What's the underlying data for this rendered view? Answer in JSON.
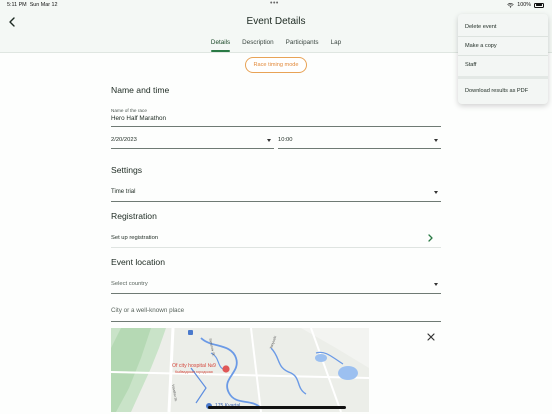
{
  "status_bar": {
    "time": "5:11 PM",
    "date": "Sun Mar 12",
    "battery": "100%"
  },
  "header": {
    "title": "Event Details",
    "tabs": [
      {
        "label": "Details",
        "active": true
      },
      {
        "label": "Description",
        "active": false
      },
      {
        "label": "Participants",
        "active": false
      },
      {
        "label": "Lap",
        "active": false
      }
    ]
  },
  "race_timing_button": "Race timing mode",
  "name_and_time": {
    "section_title": "Name and time",
    "race_name_label": "Name of the race",
    "race_name_value": "Hero Half Marathon",
    "date_value": "2/20/2023",
    "time_value": "10:00"
  },
  "settings": {
    "section_title": "Settings",
    "type_value": "Time trial"
  },
  "registration": {
    "section_title": "Registration",
    "setup_label": "Set up registration"
  },
  "event_location": {
    "section_title": "Event location",
    "country_placeholder": "Select country",
    "city_placeholder": "City or a well-known place"
  },
  "map": {
    "hospital_label": "Of city hospital №9",
    "hospital_sublabel": "Кыйвадская городская",
    "metro_label": "175 Kvartal",
    "street_labels": [
      "Simonov St.",
      "Vessilov St.",
      "Tanyushi"
    ]
  },
  "context_menu": {
    "items": [
      "Delete event",
      "Make a copy",
      "Staff",
      "Download results as PDF"
    ]
  },
  "colors": {
    "accent": "#2a7a45",
    "orange": "#e2893a",
    "header_bg": "#f4f8f5"
  }
}
